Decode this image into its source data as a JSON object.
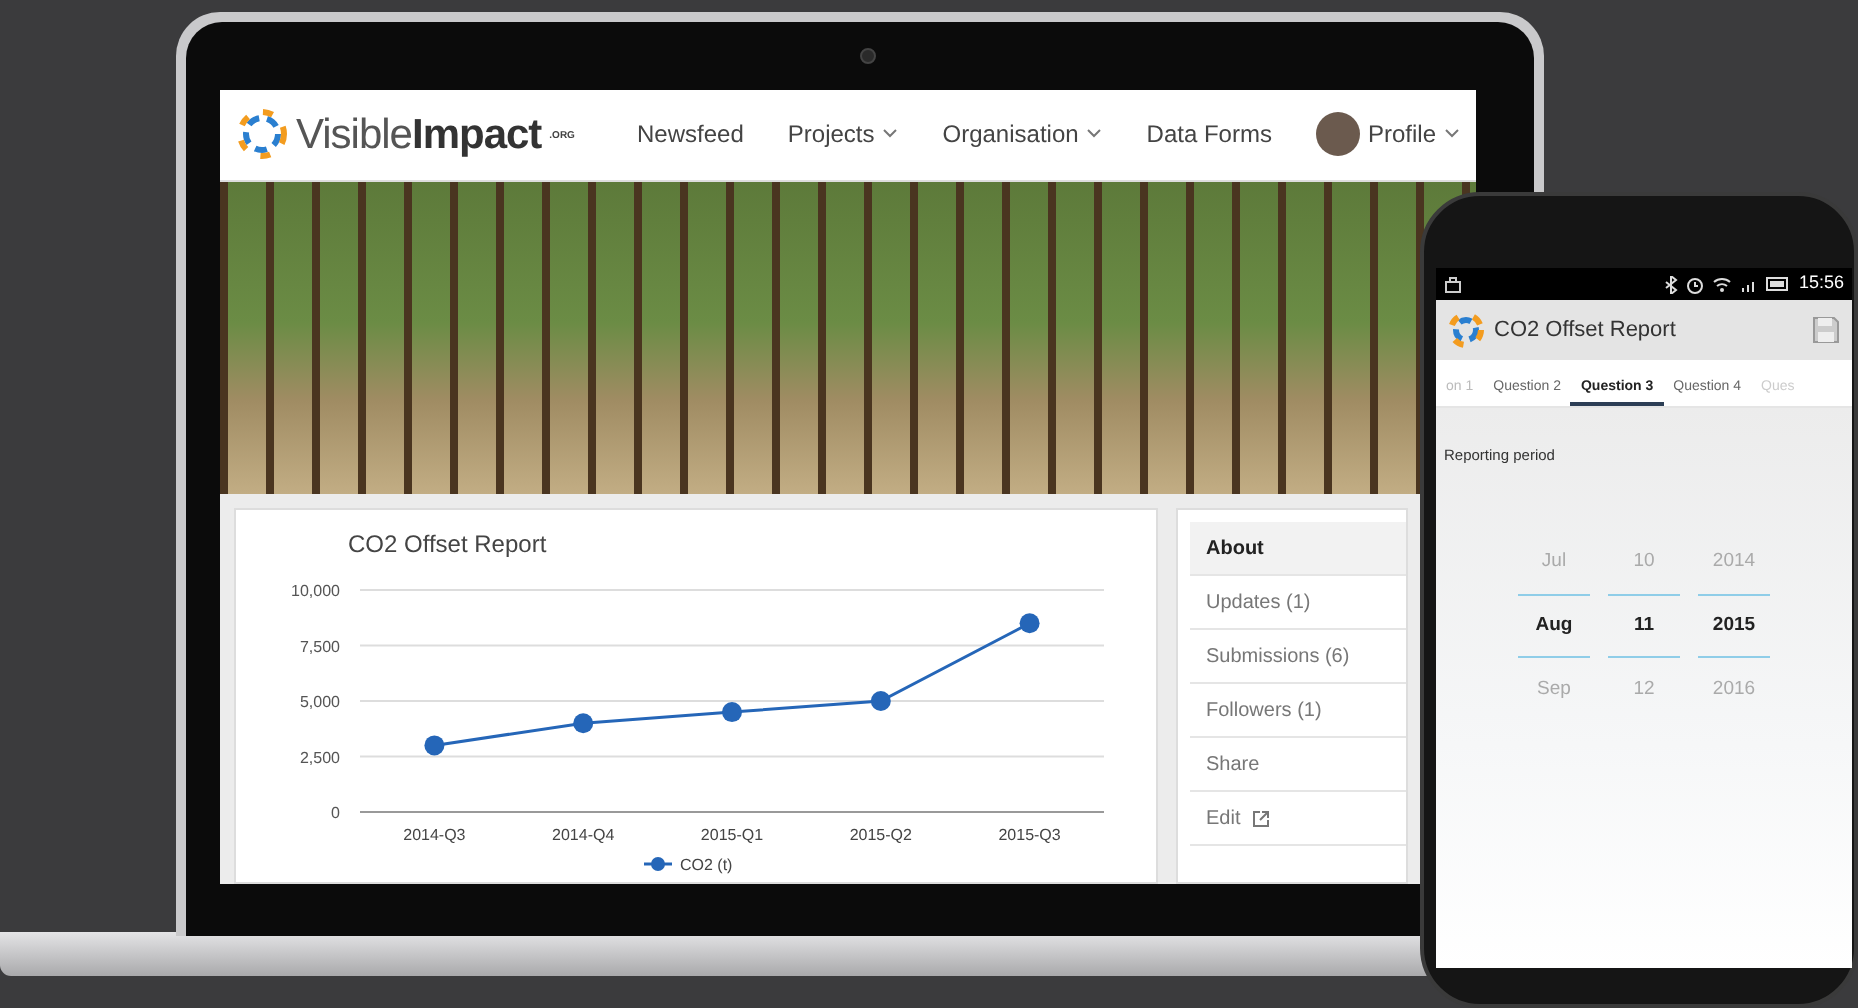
{
  "laptop": {
    "navbar": {
      "logo": {
        "name": "Visible**Impact**",
        "suffix": ".ORG"
      },
      "items": [
        {
          "label": "Newsfeed",
          "kind": "link"
        },
        {
          "label": "Projects",
          "kind": "dropdown"
        },
        {
          "label": "Organisation",
          "kind": "dropdown"
        },
        {
          "label": "Data Forms",
          "kind": "link"
        },
        {
          "label": "Profile",
          "kind": "profile"
        }
      ]
    },
    "chart_card": {
      "chart_data": {
        "type": "line",
        "title": "CO2 Offset Report",
        "categories": [
          "2014-Q3",
          "2014-Q4",
          "2015-Q1",
          "2015-Q2",
          "2015-Q3"
        ],
        "series": [
          {
            "name": "CO2 (t)",
            "color": "#2566b8",
            "marker": true,
            "values": [
              3000,
              4000,
              4500,
              5000,
              8500
            ]
          }
        ],
        "grid": true,
        "ylim": [
          0,
          10000
        ],
        "yticks": [
          {
            "value": 0,
            "label": "0"
          },
          {
            "value": 2500,
            "label": "2,500"
          },
          {
            "value": 5000,
            "label": "5,000"
          },
          {
            "value": 7500,
            "label": "7,500"
          },
          {
            "value": 10000,
            "label": "10,000"
          }
        ]
      }
    },
    "side_nav": [
      {
        "label": "About",
        "selected": true,
        "external": false
      },
      {
        "label": "Updates (1)",
        "selected": false,
        "external": false
      },
      {
        "label": "Submissions (6)",
        "selected": false,
        "external": false
      },
      {
        "label": "Followers (1)",
        "selected": false,
        "external": false
      },
      {
        "label": "Share",
        "selected": false,
        "external": false
      },
      {
        "label": "Edit",
        "selected": false,
        "external": true
      }
    ]
  },
  "phone": {
    "status_bar": {
      "time": "15:56"
    },
    "app_bar": {
      "title": "CO2 Offset Report"
    },
    "tabs": [
      {
        "label": "on 1",
        "selected": false
      },
      {
        "label": "Question 2",
        "selected": false
      },
      {
        "label": "Question 3",
        "selected": true
      },
      {
        "label": "Question 4",
        "selected": false
      },
      {
        "label": "Ques",
        "selected": false
      }
    ],
    "field": {
      "label": "Reporting period"
    },
    "picker": {
      "columns": [
        {
          "options": [
            {
              "label": "Jul",
              "selected": false
            },
            {
              "label": "Aug",
              "selected": true
            },
            {
              "label": "Sep",
              "selected": false
            }
          ]
        },
        {
          "options": [
            {
              "label": "10",
              "selected": false
            },
            {
              "label": "11",
              "selected": true
            },
            {
              "label": "12",
              "selected": false
            }
          ]
        },
        {
          "options": [
            {
              "label": "2014",
              "selected": false
            },
            {
              "label": "2015",
              "selected": true
            },
            {
              "label": "2016",
              "selected": false
            }
          ]
        }
      ]
    }
  }
}
